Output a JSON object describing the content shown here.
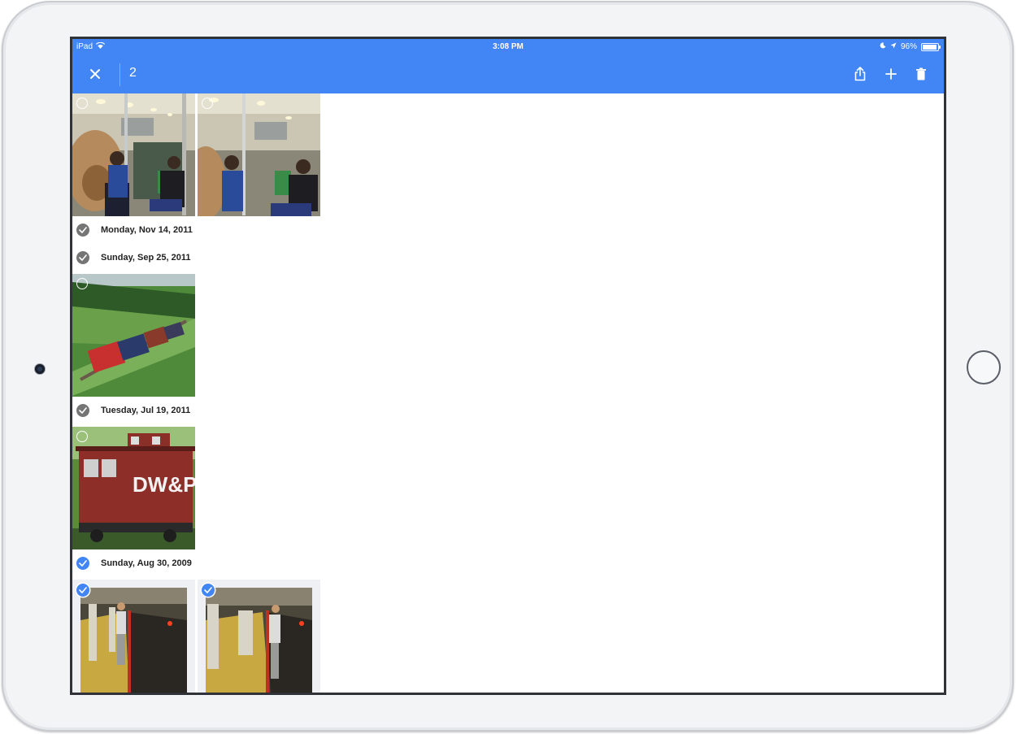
{
  "status_bar": {
    "device": "iPad",
    "time": "3:08 PM",
    "battery": "96%"
  },
  "app_bar": {
    "selected_count": "2",
    "close_icon": "close-icon",
    "actions": [
      "share-icon",
      "add-icon",
      "delete-icon"
    ],
    "accent_color": "#4285f4"
  },
  "groups": [
    {
      "date": null,
      "photos": [
        "train-interior-1",
        "train-interior-2"
      ],
      "selected": false
    },
    {
      "date": "Monday, Nov 14, 2011",
      "photos": [],
      "selected": false
    },
    {
      "date": "Sunday, Sep 25, 2011",
      "photos": [
        "freight-train"
      ],
      "selected": false
    },
    {
      "date": "Tuesday, Jul 19, 2011",
      "photos": [
        "caboose-dwp"
      ],
      "selected": false
    },
    {
      "date": "Sunday, Aug 30, 2009",
      "photos": [
        "subway-platform-1",
        "subway-platform-2"
      ],
      "selected": true
    }
  ],
  "caboose_text": "DW&P"
}
